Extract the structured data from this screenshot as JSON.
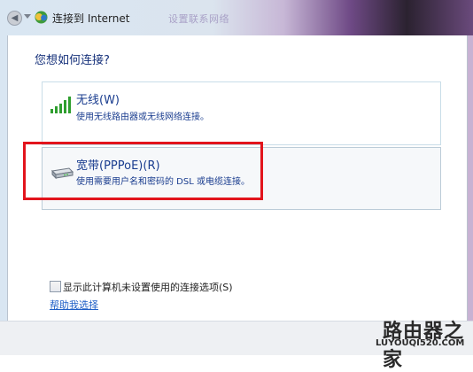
{
  "window": {
    "title": "连接到 Internet",
    "background_ghost_text": "设置联系网络",
    "icons": {
      "back": "back-arrow-icon",
      "forward": "forward-dropdown-icon",
      "app": "network-connection-icon"
    }
  },
  "main": {
    "heading": "您想如何连接?",
    "options": [
      {
        "title": "无线(W)",
        "description": "使用无线路由器或无线网络连接。",
        "icon": "wireless-signal-icon"
      },
      {
        "title": "宽带(PPPoE)(R)",
        "description": "使用需要用户名和密码的 DSL 或电缆连接。",
        "icon": "broadband-modem-icon"
      }
    ],
    "checkbox_label": "显示此计算机未设置使用的连接选项(S)",
    "checkbox_checked": false,
    "help_link": "帮助我选择"
  },
  "watermark": {
    "chinese": "路由器之家",
    "url": "LUYOUQI520.COM"
  },
  "colors": {
    "highlight_box": "#e2141c",
    "option_text": "#1a3d8f",
    "link": "#1f5fc7"
  }
}
